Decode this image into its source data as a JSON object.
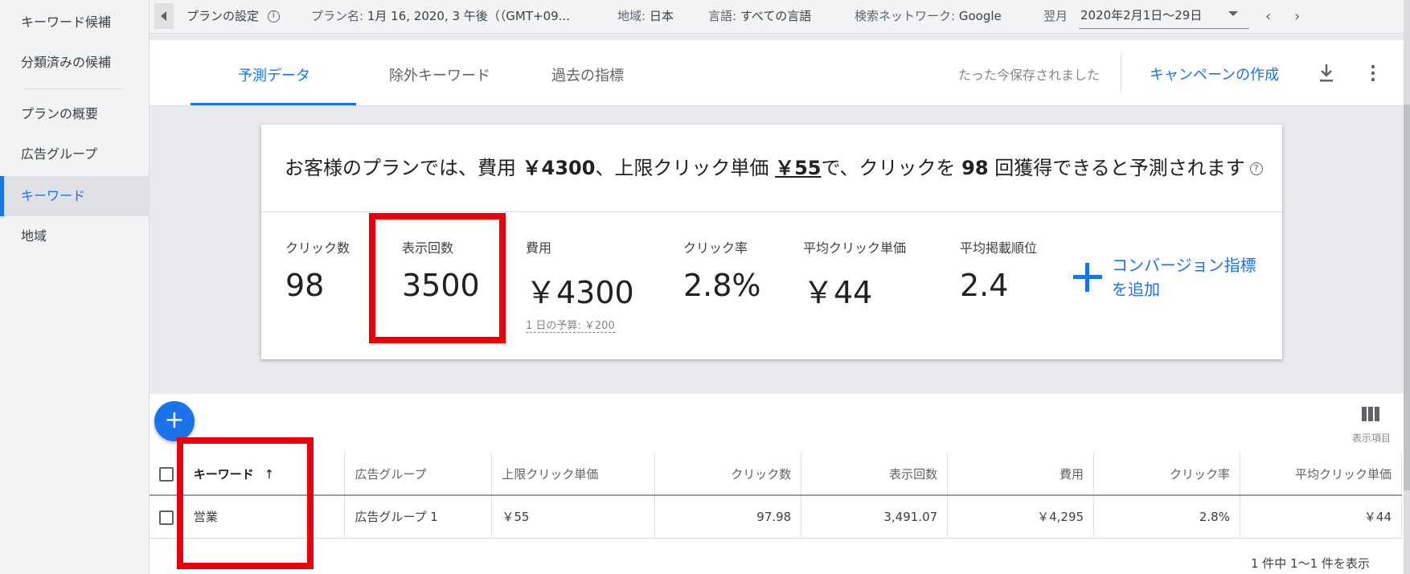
{
  "sidebar": {
    "items": [
      {
        "label": "キーワード候補"
      },
      {
        "label": "分類済みの候補"
      },
      {
        "label": "プランの概要"
      },
      {
        "label": "広告グループ"
      },
      {
        "label": "キーワード"
      },
      {
        "label": "地域"
      }
    ],
    "active_index": 4
  },
  "topbar": {
    "plan_settings": "プランの設定",
    "plan_name_label": "プラン名:",
    "plan_name": "1月 16, 2020, 3 午後（（GMT+09...",
    "region_label": "地域:",
    "region": "日本",
    "language_label": "言語:",
    "language": "すべての言語",
    "network_label": "検索ネットワーク:",
    "network": "Google",
    "period_label": "翌月",
    "period": "2020年2月1日～29日"
  },
  "tabs": [
    {
      "label": "予測データ"
    },
    {
      "label": "除外キーワード"
    },
    {
      "label": "過去の指標"
    }
  ],
  "header_actions": {
    "saved_status": "たった今保存されました",
    "create_campaign": "キャンペーンの作成"
  },
  "forecast": {
    "summary_1": "お客様のプランでは、費用 ",
    "summary_cost": "￥4300",
    "summary_2": "、上限クリック単価 ",
    "summary_maxcpc": "￥55",
    "summary_3": "で、クリックを ",
    "summary_clicks": "98",
    "summary_4": " 回獲得できると予測されます",
    "metrics": [
      {
        "label": "クリック数",
        "value": "98"
      },
      {
        "label": "表示回数",
        "value": "3500"
      },
      {
        "label": "費用",
        "value": "￥4300"
      },
      {
        "label": "クリック率",
        "value": "2.8%"
      },
      {
        "label": "平均クリック単価",
        "value": "￥44"
      },
      {
        "label": "平均掲載順位",
        "value": "2.4"
      }
    ],
    "daily_budget": "1 日の予算: ￥200",
    "add_conversion_line1": "コンバージョン指標",
    "add_conversion_line2": "を追加"
  },
  "table": {
    "columns_label": "表示項目",
    "headers": [
      "キーワード",
      "広告グループ",
      "上限クリック単価",
      "クリック数",
      "表示回数",
      "費用",
      "クリック率",
      "平均クリック単価"
    ],
    "rows": [
      {
        "keyword": "営業",
        "ad_group": "広告グループ 1",
        "max_cpc": "￥55",
        "clicks": "97.98",
        "impressions": "3,491.07",
        "cost": "￥4,295",
        "ctr": "2.8%",
        "avg_cpc": "￥44"
      }
    ],
    "pagination": "1 件中 1～1 件を表示"
  },
  "colors": {
    "accent": "#1a73e8",
    "highlight": "#e8000b"
  }
}
